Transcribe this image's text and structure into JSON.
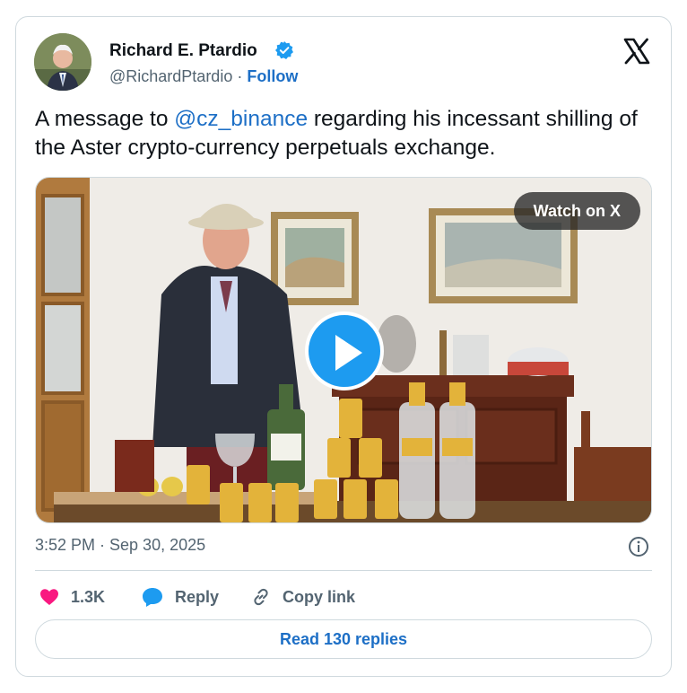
{
  "author": {
    "name": "Richard E. Ptardio",
    "handle": "@RichardPtardio",
    "separator": " · ",
    "follow_label": "Follow",
    "verified": true,
    "avatar_icon": "user-avatar-photo"
  },
  "tweet": {
    "text_before": "A message to ",
    "mention": "@cz_binance",
    "text_after": " regarding his incessant shilling of the Aster crypto-currency perpetuals exchange.",
    "timestamp": "3:52 PM · Sep 30, 2025"
  },
  "media": {
    "watch_label": "Watch on X",
    "play_icon": "play-icon"
  },
  "actions": {
    "like_count": "1.3K",
    "reply_label": "Reply",
    "copy_link_label": "Copy link",
    "read_replies_label": "Read 130 replies"
  },
  "colors": {
    "link": "#1d6fc6",
    "like": "#f91880",
    "reply": "#1d9bf0",
    "secondary_text": "#536471",
    "border": "#cfd9de"
  }
}
